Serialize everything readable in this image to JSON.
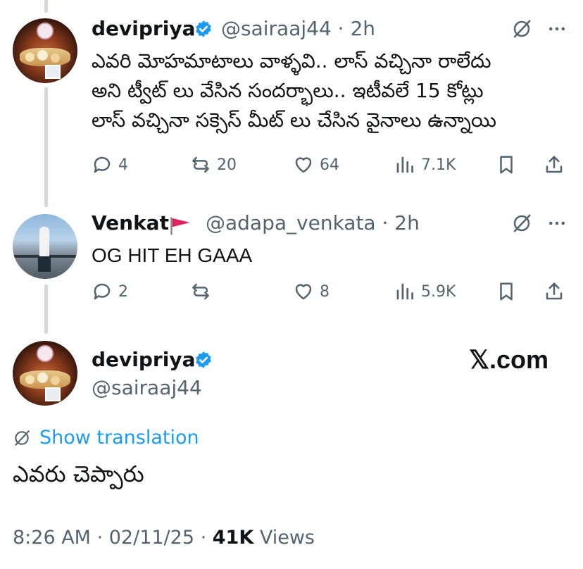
{
  "tweets": [
    {
      "name": "devipriya",
      "handle": "@sairaaj44",
      "time": "2h",
      "text_lines": [
        "ఎవరి మోహమాటాలు వాళ్ళవి.. లాస్ వచ్చినా రాలేదు",
        "అని ట్వీట్ లు వేసిన సందర్భాలు.. ఇటీవలే 15 కోట్లు",
        "లాస్ వచ్చినా సక్సెస్ మీట్ లు చేసిన వైనాలు ఉన్నాయి"
      ],
      "replies": "4",
      "reposts": "20",
      "likes": "64",
      "views": "7.1K"
    },
    {
      "name": "Venkat",
      "handle": "@adapa_venkata",
      "time": "2h",
      "text_lines": [
        "OG HIT EH GAAA"
      ],
      "replies": "2",
      "reposts": "",
      "likes": "8",
      "views": "5.9K"
    }
  ],
  "main": {
    "name": "devipriya",
    "handle": "@sairaaj44",
    "show_translation": "Show translation",
    "text": "ఎవరు చెప్పారు",
    "time": "8:26 AM",
    "date": "02/11/25",
    "views_count": "41K",
    "views_label": "Views"
  },
  "watermark": "𝕏.com",
  "colors": {
    "verified": "#1d9bf0",
    "link": "#1d9bf0",
    "secondary_text": "#536471",
    "flag": "#e0245e"
  }
}
